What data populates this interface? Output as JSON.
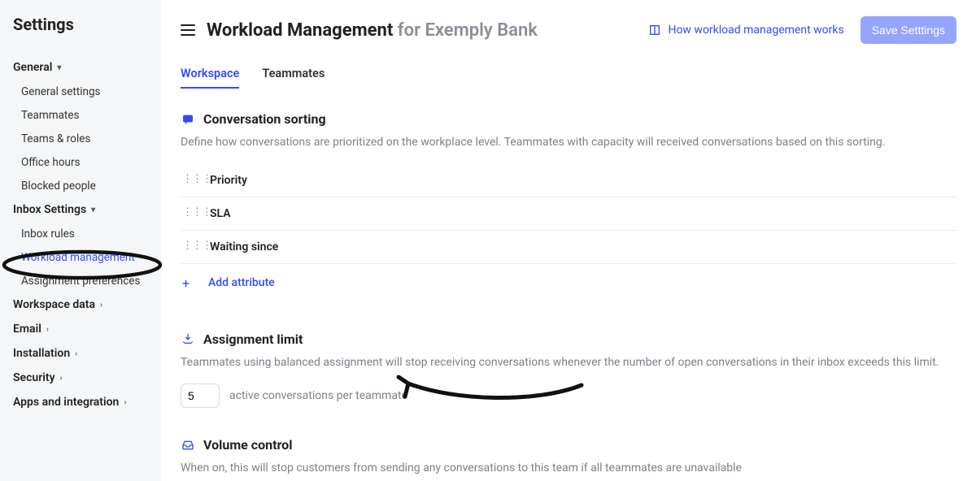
{
  "sidebar": {
    "title": "Settings",
    "groups": [
      {
        "label": "General",
        "expanded": true,
        "items": [
          {
            "label": "General settings"
          },
          {
            "label": "Teammates"
          },
          {
            "label": "Teams & roles"
          },
          {
            "label": "Office hours"
          },
          {
            "label": "Blocked people"
          }
        ]
      },
      {
        "label": "Inbox Settings",
        "expanded": true,
        "items": [
          {
            "label": "Inbox rules"
          },
          {
            "label": "Workload management",
            "active": true
          },
          {
            "label": "Assignment preferences"
          }
        ]
      },
      {
        "label": "Workspace data",
        "expanded": false,
        "items": []
      },
      {
        "label": "Email",
        "expanded": false,
        "items": []
      },
      {
        "label": "Installation",
        "expanded": false,
        "items": []
      },
      {
        "label": "Security",
        "expanded": false,
        "items": []
      },
      {
        "label": "Apps and integration",
        "expanded": false,
        "items": []
      }
    ]
  },
  "header": {
    "title": "Workload Management",
    "title_suffix": "for Exemply Bank",
    "help_link": "How workload management works",
    "save_label": "Save Setttings"
  },
  "tabs": [
    {
      "label": "Workspace",
      "active": true
    },
    {
      "label": "Teammates",
      "active": false
    }
  ],
  "sections": {
    "sorting": {
      "title": "Conversation sorting",
      "description": "Define how conversations are prioritized on the workplace level. Teammates with capacity will received conversations based on this sorting.",
      "rows": [
        {
          "label": "Priority"
        },
        {
          "label": "SLA"
        },
        {
          "label": "Waiting since"
        }
      ],
      "add_label": "Add attribute"
    },
    "limit": {
      "title": "Assignment limit",
      "description": "Teammates using balanced assignment will stop receiving conversations whenever the number of open conversations in their inbox exceeds this limit.",
      "value": "5",
      "suffix": "active conversations per teammate"
    },
    "volume": {
      "title": "Volume control",
      "description": "When on, this will stop customers from sending any conversations to this team if all teammates are unavailable"
    }
  }
}
